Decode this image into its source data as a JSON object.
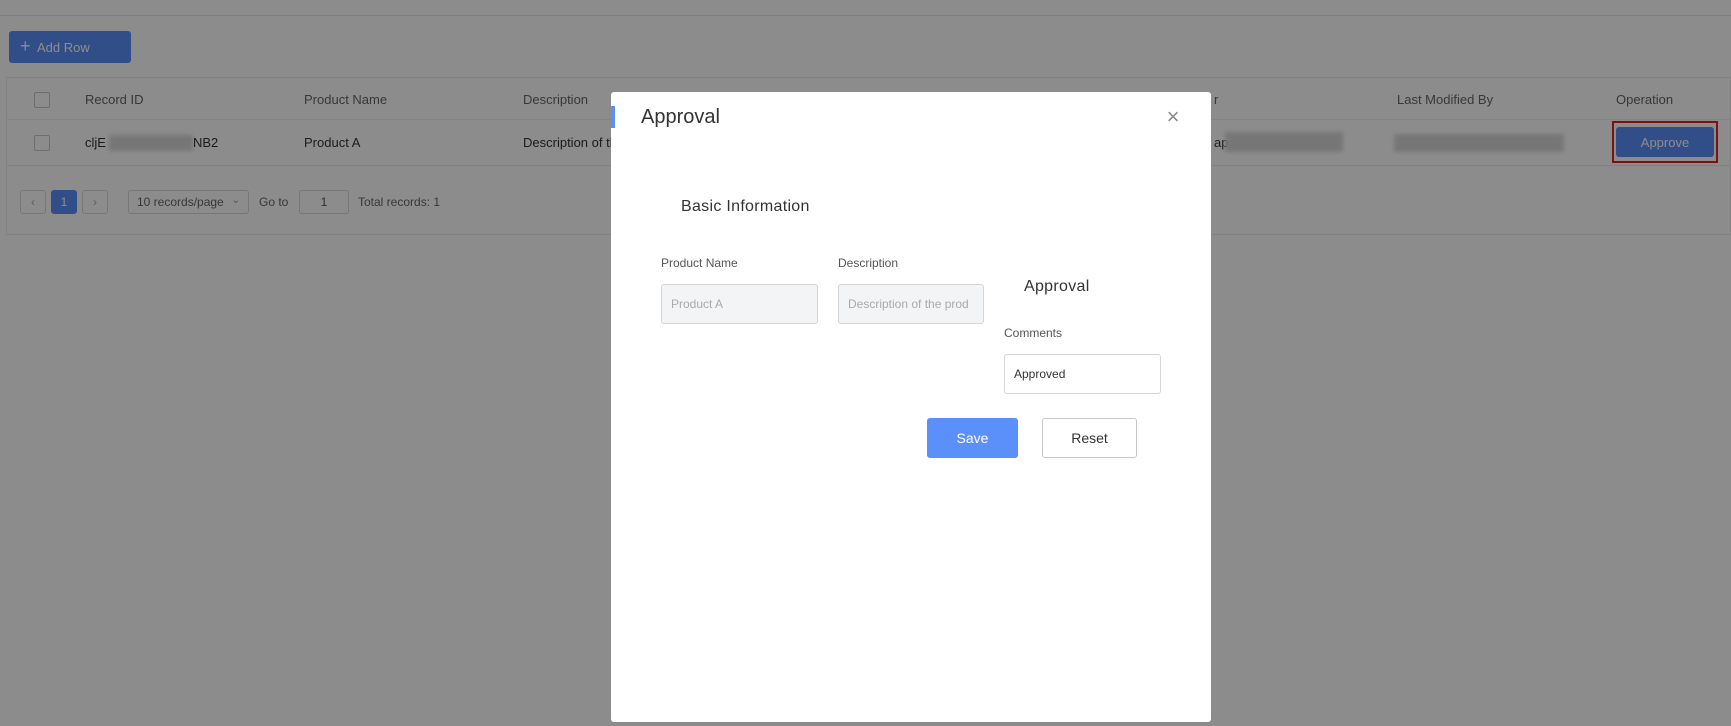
{
  "toolbar": {
    "add_row_label": "Add Row",
    "add_icon": "plus-icon"
  },
  "table": {
    "columns": [
      "Record ID",
      "Product Name",
      "Description",
      "r",
      "Last Modified By",
      "Operation"
    ],
    "row": {
      "record_id_prefix": "cljE",
      "record_id_suffix": "NB2",
      "product_name": "Product A",
      "description": "Description of th",
      "creator_fragment": "ap",
      "operation_label": "Approve"
    }
  },
  "pagination": {
    "prev_icon": "‹",
    "page": "1",
    "next_icon": "›",
    "page_size": "10 records/page",
    "goto_label": "Go to",
    "goto_value": "1",
    "total_label": "Total records: 1"
  },
  "modal": {
    "title": "Approval",
    "close_icon": "×",
    "basic_section": "Basic Information",
    "product_name_label": "Product Name",
    "product_name_placeholder": "Product A",
    "description_label": "Description",
    "description_placeholder": "Description of the prod",
    "approval_section": "Approval",
    "comments_label": "Comments",
    "comments_value": "Approved",
    "save_label": "Save",
    "reset_label": "Reset"
  },
  "colors": {
    "primary": "#5b8ff9",
    "highlight": "#e02020"
  }
}
